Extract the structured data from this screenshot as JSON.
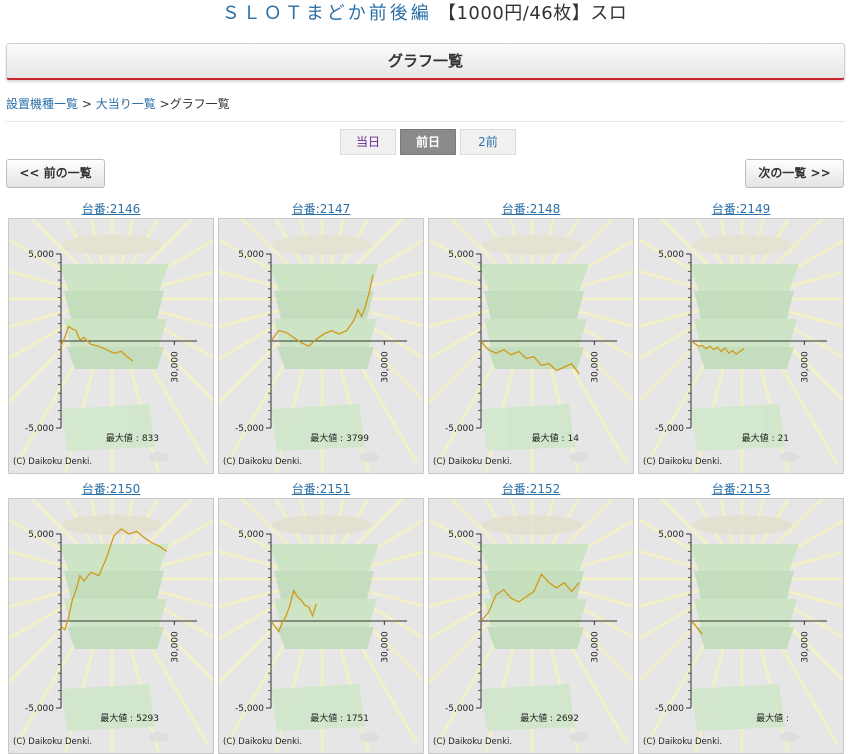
{
  "header": {
    "title_prefix": "ＳＬＯＴまどか前後編",
    "title_suffix": "【1000円/46枚】スロ",
    "section_title": "グラフ一覧"
  },
  "breadcrumb": {
    "item1": "設置機種一覧",
    "sep1": " >",
    "item2": "大当り一覧",
    "sep2": " >",
    "current": "グラフ一覧"
  },
  "day_tabs": [
    "当日",
    "前日",
    "2前"
  ],
  "active_tab": 1,
  "nav": {
    "prev": "<< 前の一覧",
    "next": "次の一覧 >>"
  },
  "colors": {
    "line": "#d19a18",
    "link": "#2b6fa8",
    "accent": "#c6262e"
  },
  "chart_common": {
    "type": "line",
    "y_ticks": [
      "5,000",
      "-5,000"
    ],
    "ylim": [
      -5000,
      5000
    ],
    "x_tick": "30,000",
    "max_label": "最大値 :",
    "copyright": "(C) Daikoku Denki."
  },
  "chart_data": [
    {
      "type": "line",
      "title": "台番:2146",
      "max": "833",
      "x": [
        0,
        1000,
        2000,
        3000,
        4000,
        5000,
        6000,
        8000,
        10000,
        12000,
        14000,
        16000,
        17500,
        19000
      ],
      "y": [
        -250,
        200,
        833,
        700,
        600,
        50,
        200,
        -200,
        -300,
        -500,
        -700,
        -600,
        -900,
        -1150
      ]
    },
    {
      "type": "line",
      "title": "台番:2147",
      "max": "3799",
      "x": [
        0,
        2000,
        4000,
        6000,
        8000,
        10000,
        12000,
        14000,
        16000,
        18000,
        20000,
        22000,
        23000,
        24000,
        25000,
        26000,
        27000
      ],
      "y": [
        0,
        600,
        500,
        200,
        -100,
        -300,
        100,
        400,
        600,
        400,
        600,
        1200,
        1800,
        1400,
        2000,
        2800,
        3799
      ]
    },
    {
      "type": "line",
      "title": "台番:2148",
      "max": "14",
      "x": [
        0,
        1000,
        2000,
        4000,
        6000,
        8000,
        10000,
        12000,
        14000,
        16000,
        18000,
        20000,
        22000,
        24000,
        26000
      ],
      "y": [
        14,
        -300,
        -500,
        -700,
        -500,
        -800,
        -600,
        -1000,
        -900,
        -1400,
        -1300,
        -1700,
        -1500,
        -1300,
        -1900
      ]
    },
    {
      "type": "line",
      "title": "台番:2149",
      "max": "21",
      "x": [
        0,
        1000,
        2000,
        3000,
        4000,
        5000,
        6000,
        7000,
        8000,
        9000,
        10000,
        11000,
        12000,
        13000,
        14000
      ],
      "y": [
        21,
        -150,
        -300,
        -250,
        -450,
        -300,
        -500,
        -350,
        -600,
        -400,
        -700,
        -550,
        -750,
        -600,
        -450
      ]
    },
    {
      "type": "line",
      "title": "台番:2150",
      "max": "5293",
      "x": [
        0,
        1000,
        2000,
        3000,
        4000,
        5000,
        6000,
        8000,
        10000,
        12000,
        14000,
        16000,
        18000,
        20000,
        22000,
        24000,
        26000,
        28000
      ],
      "y": [
        -300,
        -500,
        200,
        1200,
        1800,
        2600,
        2300,
        2800,
        2600,
        3600,
        4900,
        5293,
        5000,
        5150,
        4800,
        4500,
        4300,
        4000
      ]
    },
    {
      "type": "line",
      "title": "台番:2151",
      "max": "1751",
      "x": [
        0,
        1000,
        2000,
        3000,
        4000,
        5000,
        6000,
        7000,
        8000,
        9000,
        10000,
        11000,
        12000
      ],
      "y": [
        0,
        -300,
        -600,
        -100,
        300,
        900,
        1751,
        1400,
        1200,
        900,
        800,
        300,
        1000
      ]
    },
    {
      "type": "line",
      "title": "台番:2152",
      "max": "2692",
      "x": [
        0,
        2000,
        4000,
        6000,
        8000,
        10000,
        12000,
        14000,
        16000,
        18000,
        20000,
        22000,
        24000,
        26000
      ],
      "y": [
        0,
        500,
        1500,
        1800,
        1300,
        1100,
        1400,
        1700,
        2692,
        2200,
        1900,
        2200,
        1700,
        2200
      ]
    },
    {
      "type": "line",
      "title": "台番:2153",
      "max": "",
      "x": [
        0,
        1000,
        2000,
        3000
      ],
      "y": [
        0,
        -200,
        -500,
        -750
      ]
    }
  ]
}
